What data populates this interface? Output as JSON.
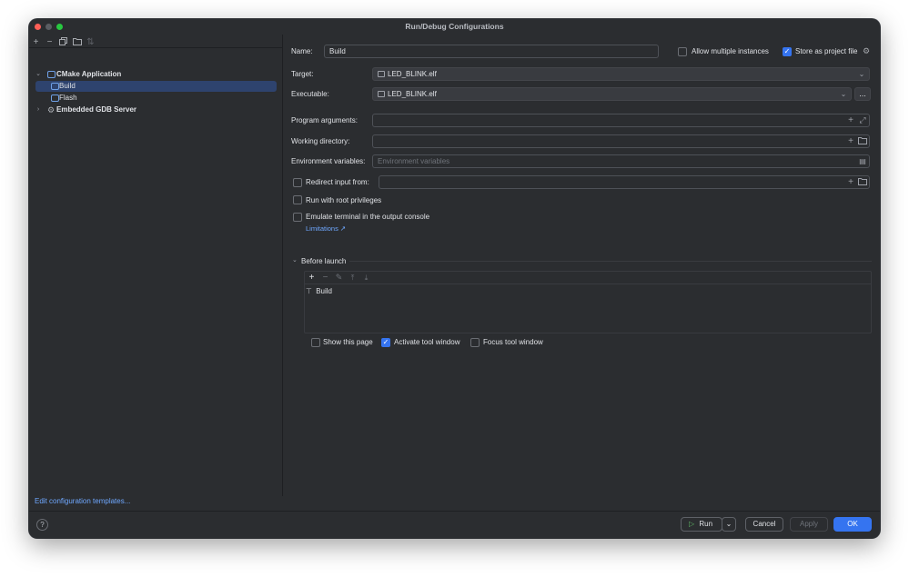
{
  "window": {
    "title": "Run/Debug Configurations"
  },
  "left_toolbar": {
    "icons": [
      "add-icon",
      "remove-icon",
      "copy-icon",
      "folder-icon",
      "sort-icon"
    ]
  },
  "tree": {
    "groups": [
      {
        "label": "CMake Application",
        "expanded": true,
        "items": [
          {
            "label": "Build",
            "selected": true
          },
          {
            "label": "Flash",
            "selected": false
          }
        ]
      },
      {
        "label": "Embedded GDB Server",
        "expanded": false
      }
    ]
  },
  "edit_templates_link": "Edit configuration templates...",
  "help_label": "?",
  "form": {
    "name_label": "Name:",
    "name_value": "Build",
    "allow_multiple_label": "Allow multiple instances",
    "allow_multiple_checked": false,
    "store_project_label": "Store as project file",
    "store_project_checked": true,
    "target_label": "Target:",
    "target_value": "LED_BLINK.elf",
    "executable_label": "Executable:",
    "executable_value": "LED_BLINK.elf",
    "browse_label": "...",
    "program_args_label": "Program arguments:",
    "program_args_value": "",
    "working_dir_label": "Working directory:",
    "working_dir_value": "",
    "env_vars_label": "Environment variables:",
    "env_vars_placeholder": "Environment variables",
    "redirect_label": "Redirect input from:",
    "redirect_checked": false,
    "root_label": "Run with root privileges",
    "root_checked": false,
    "emulate_label": "Emulate terminal in the output console",
    "emulate_checked": false,
    "limitations_link": "Limitations ↗"
  },
  "before_launch": {
    "title": "Before launch",
    "tasks": [
      {
        "label": "Build"
      }
    ],
    "show_page_label": "Show this page",
    "show_page_checked": false,
    "activate_label": "Activate tool window",
    "activate_checked": true,
    "focus_label": "Focus tool window",
    "focus_checked": false
  },
  "buttons": {
    "run": "Run",
    "cancel": "Cancel",
    "apply": "Apply",
    "ok": "OK"
  },
  "colors": {
    "accent": "#3574f0",
    "link": "#6fa8ff",
    "background": "#2b2d30",
    "selection": "#2e436e"
  }
}
